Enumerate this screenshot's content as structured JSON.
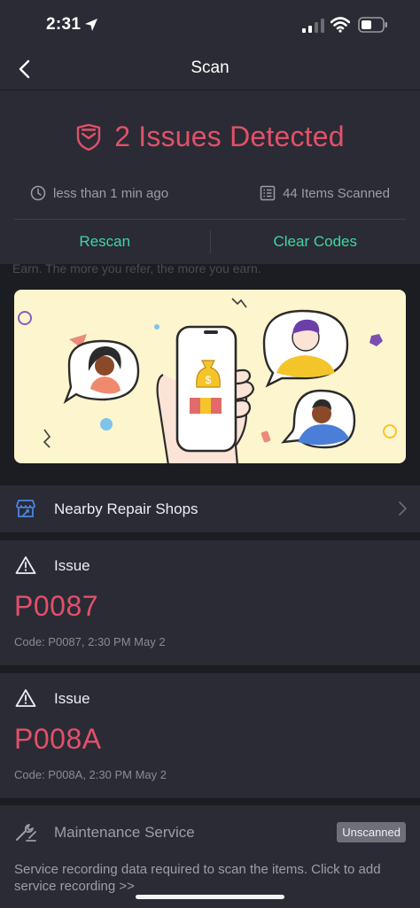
{
  "status_bar": {
    "time": "2:31"
  },
  "nav": {
    "title": "Scan"
  },
  "summary": {
    "title": "2 Issues Detected",
    "last_scan": "less than 1 min ago",
    "items_scanned": "44 Items Scanned",
    "rescan_label": "Rescan",
    "clear_codes_label": "Clear Codes"
  },
  "peek_text": "Earn. The more you refer, the more you earn.",
  "repair_shops": {
    "label": "Nearby Repair Shops"
  },
  "issues": [
    {
      "label": "Issue",
      "code": "P0087",
      "meta": "Code: P0087, 2:30 PM May 2"
    },
    {
      "label": "Issue",
      "code": "P008A",
      "meta": "Code: P008A, 2:30 PM May 2"
    }
  ],
  "maintenance": {
    "label": "Maintenance Service",
    "badge": "Unscanned",
    "description": "Service recording data required to scan the items. Click to add service recording >>"
  },
  "colors": {
    "accent_red": "#e2506a",
    "accent_green": "#3fd6a6",
    "card_bg": "#2a2b34",
    "page_bg": "#1c1d22"
  },
  "icons": [
    "location-arrow-icon",
    "signal-icon",
    "wifi-icon",
    "battery-icon",
    "back-chevron-icon",
    "shield-icon",
    "clock-icon",
    "list-icon",
    "repair-shop-icon",
    "chevron-right-icon",
    "warning-icon",
    "wrench-icon"
  ]
}
